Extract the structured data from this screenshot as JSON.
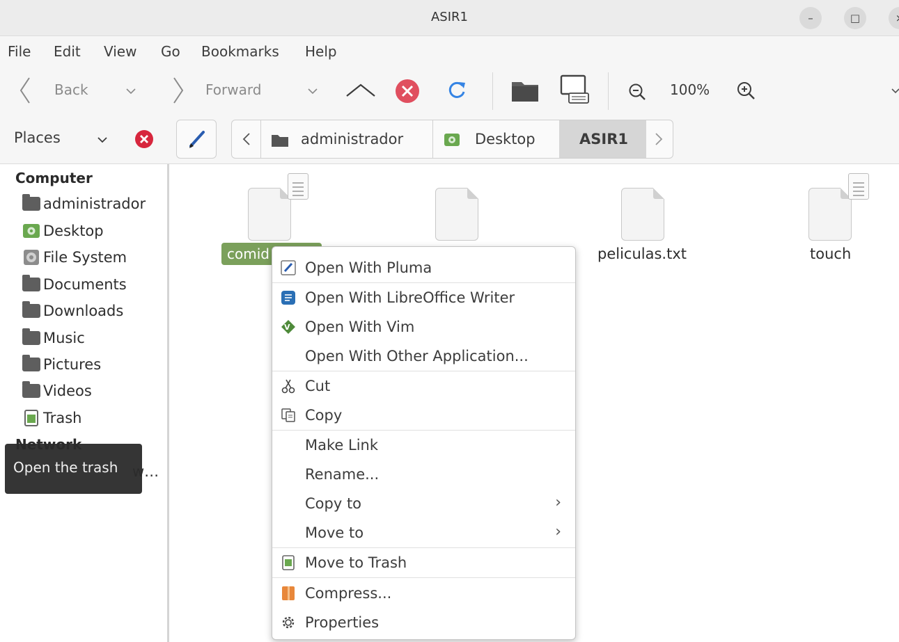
{
  "window": {
    "title": "ASIR1",
    "minimize_label": "–",
    "maximize_label": "□",
    "close_label": "×"
  },
  "menubar": [
    "File",
    "Edit",
    "View",
    "Go",
    "Bookmarks",
    "Help"
  ],
  "toolbar": {
    "back_label": "Back",
    "forward_label": "Forward",
    "zoom_level": "100%"
  },
  "location": {
    "places_label": "Places",
    "crumbs": [
      "administrador",
      "Desktop",
      "ASIR1"
    ]
  },
  "sidebar": {
    "computer_heading": "Computer",
    "items": [
      {
        "label": "administrador",
        "icon": "home-folder-icon"
      },
      {
        "label": "Desktop",
        "icon": "desktop-icon"
      },
      {
        "label": "File System",
        "icon": "drive-icon"
      },
      {
        "label": "Documents",
        "icon": "folder-icon"
      },
      {
        "label": "Downloads",
        "icon": "folder-icon"
      },
      {
        "label": "Music",
        "icon": "folder-icon"
      },
      {
        "label": "Pictures",
        "icon": "folder-icon"
      },
      {
        "label": "Videos",
        "icon": "folder-icon"
      },
      {
        "label": "Trash",
        "icon": "trash-icon"
      }
    ],
    "network_heading": "Network",
    "network_item_partial": "w…"
  },
  "tooltip": "Open the trash",
  "files": [
    {
      "name": "comid",
      "selected": true
    },
    {
      "name": "",
      "selected": false
    },
    {
      "name": "peliculas.txt",
      "selected": false
    },
    {
      "name": "touch",
      "selected": false
    }
  ],
  "context_menu": {
    "items": [
      {
        "label": "Open With Pluma",
        "icon": "pluma-icon"
      },
      {
        "label": "Open With LibreOffice Writer",
        "icon": "libreoffice-writer-icon"
      },
      {
        "label": "Open With Vim",
        "icon": "vim-icon"
      },
      {
        "label": "Open With Other Application...",
        "icon": ""
      },
      {
        "label": "Cut",
        "icon": "scissors-icon"
      },
      {
        "label": "Copy",
        "icon": "copy-icon"
      },
      {
        "label": "Make Link",
        "icon": ""
      },
      {
        "label": "Rename...",
        "icon": ""
      },
      {
        "label": "Copy to",
        "icon": "",
        "submenu": true
      },
      {
        "label": "Move to",
        "icon": "",
        "submenu": true
      },
      {
        "label": "Move to Trash",
        "icon": "trash-icon"
      },
      {
        "label": "Compress...",
        "icon": "archive-icon"
      },
      {
        "label": "Properties",
        "icon": "gear-icon"
      }
    ]
  },
  "colors": {
    "selection": "#7ba05b",
    "stop_red": "#e04f5f",
    "reload_blue": "#3584e4"
  }
}
